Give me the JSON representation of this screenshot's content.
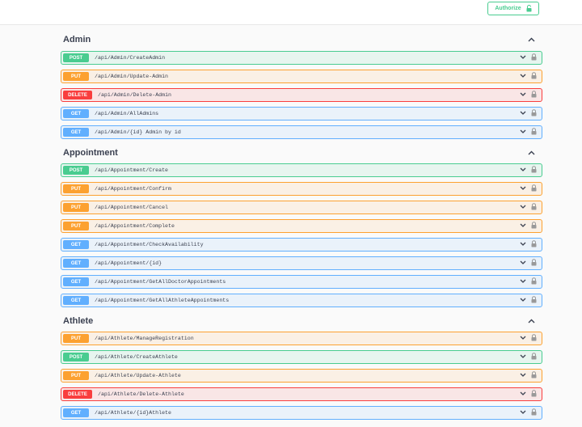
{
  "topbar": {
    "authorize_label": "Authorize",
    "authorize_icon": "unlocked-lock-icon"
  },
  "colors": {
    "post": "#49cc90",
    "put": "#fca130",
    "delete": "#f93e3e",
    "get": "#61affe"
  },
  "sections": [
    {
      "title": "Admin",
      "ops": [
        {
          "method": "POST",
          "path": "/api/Admin/CreateAdmin"
        },
        {
          "method": "PUT",
          "path": "/api/Admin/Update-Admin"
        },
        {
          "method": "DELETE",
          "path": "/api/Admin/Delete-Admin"
        },
        {
          "method": "GET",
          "path": "/api/Admin/AllAdmins"
        },
        {
          "method": "GET",
          "path": "/api/Admin/{id} Admin by id"
        }
      ]
    },
    {
      "title": "Appointment",
      "ops": [
        {
          "method": "POST",
          "path": "/api/Appointment/Create"
        },
        {
          "method": "PUT",
          "path": "/api/Appointment/Confirm"
        },
        {
          "method": "PUT",
          "path": "/api/Appointment/Cancel"
        },
        {
          "method": "PUT",
          "path": "/api/Appointment/Complete"
        },
        {
          "method": "GET",
          "path": "/api/Appointment/CheckAvailability"
        },
        {
          "method": "GET",
          "path": "/api/Appointment/{id}"
        },
        {
          "method": "GET",
          "path": "/api/Appointment/GetAllDoctorAppointments"
        },
        {
          "method": "GET",
          "path": "/api/Appointment/GetAllAthleteAppointments"
        }
      ]
    },
    {
      "title": "Athlete",
      "ops": [
        {
          "method": "PUT",
          "path": "/api/Athlete/ManageRegistration"
        },
        {
          "method": "POST",
          "path": "/api/Athlete/CreateAthlete"
        },
        {
          "method": "PUT",
          "path": "/api/Athlete/Update-Athlete"
        },
        {
          "method": "DELETE",
          "path": "/api/Athlete/Delete-Athlete"
        },
        {
          "method": "GET",
          "path": "/api/Athlete/{id}Athlete"
        }
      ]
    }
  ]
}
